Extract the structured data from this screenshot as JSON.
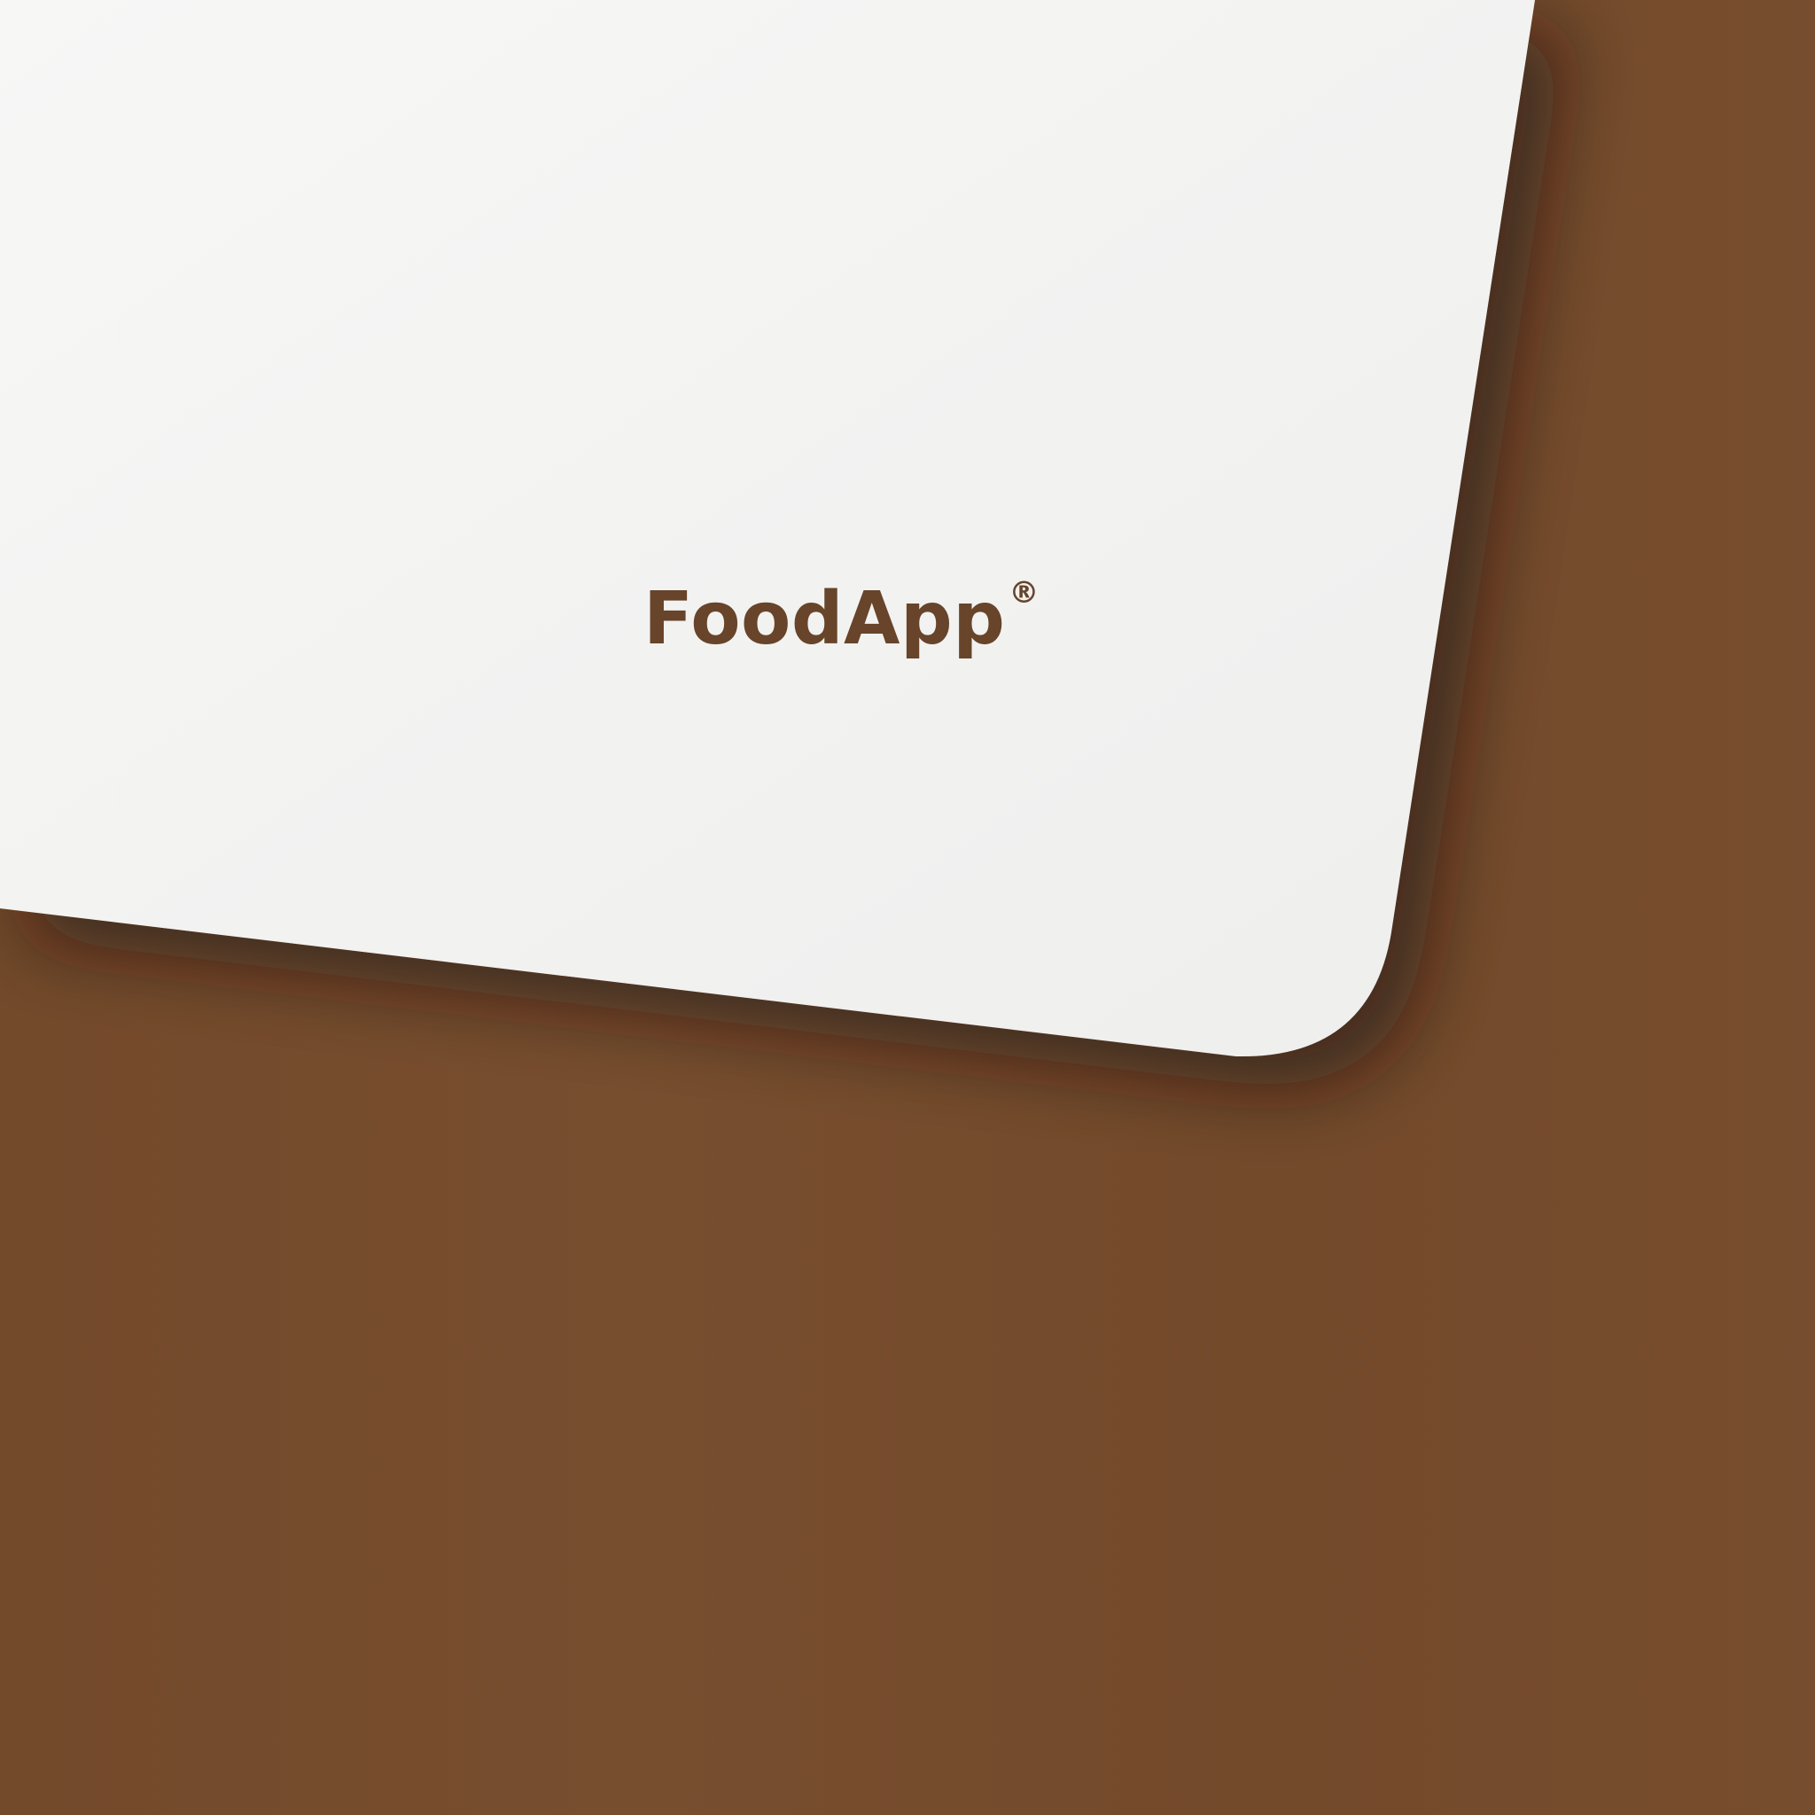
{
  "brand": {
    "name": "FoodApp",
    "registered_mark": "®"
  },
  "colors": {
    "background": "#754b2b",
    "card": "#f4f4f2",
    "logo_text": "#67442a"
  }
}
